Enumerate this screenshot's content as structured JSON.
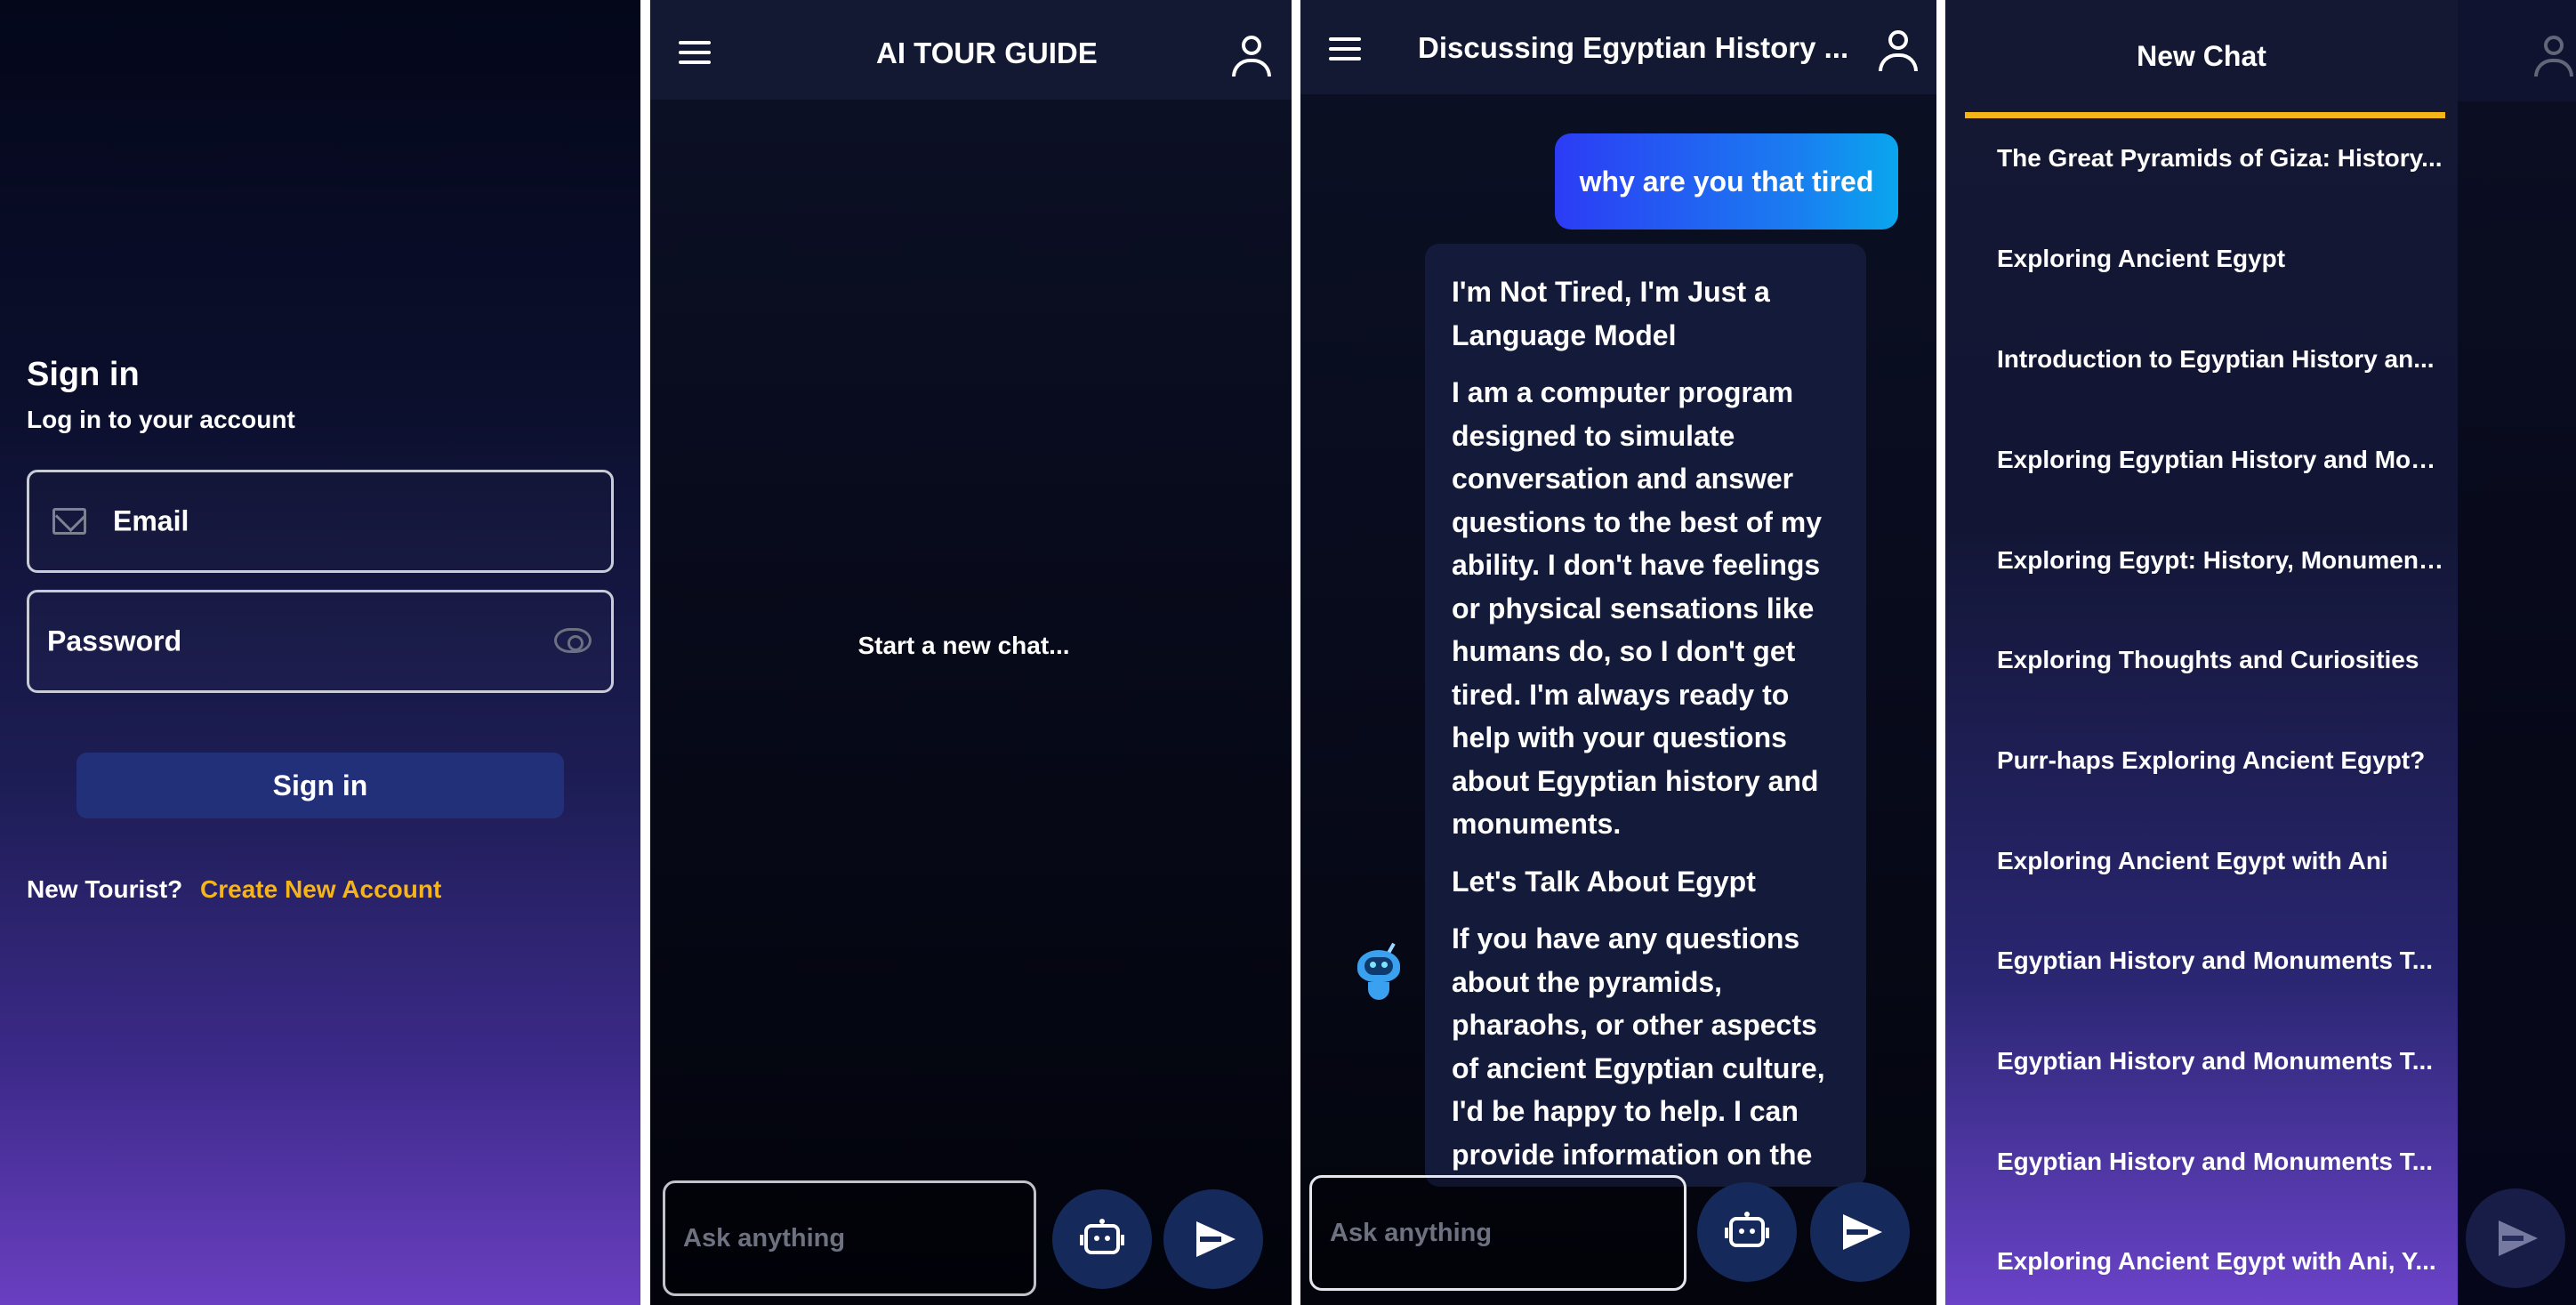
{
  "signin": {
    "title": "Sign in",
    "subtitle": "Log in to your account",
    "email_label": "Email",
    "password_label": "Password",
    "button_label": "Sign in",
    "new_tourist_text": "New Tourist?",
    "create_account_link": "Create New Account",
    "accent_color": "#f4b41a"
  },
  "home": {
    "title": "AI TOUR GUIDE",
    "empty_text": "Start a new chat...",
    "input_placeholder": "Ask anything"
  },
  "chat": {
    "title": "Discussing Egyptian History ...",
    "user_message": "why are you that tired",
    "bot_paragraphs": [
      "I'm Not Tired, I'm Just a Language Model",
      "I am a computer program designed to simulate conversation and answer questions to the best of my ability. I don't have feelings or physical sensations like humans do, so I don't get tired. I'm always ready to help with your questions about Egyptian history and monuments.",
      "Let's Talk About Egypt",
      "If you have any questions about the pyramids, pharaohs, or other aspects of ancient Egyptian culture, I'd be happy to help. I can provide information on the"
    ],
    "input_placeholder": "Ask anything"
  },
  "drawer": {
    "title": "New Chat",
    "items": [
      "The Great Pyramids of Giza: History...",
      "Exploring Ancient Egypt",
      "Introduction to Egyptian History an...",
      "Exploring Egyptian History and Mon...",
      "Exploring Egypt: History, Monument...",
      "Exploring Thoughts and Curiosities",
      "Purr-haps Exploring Ancient Egypt?",
      "Exploring Ancient Egypt with Ani",
      "Egyptian History and Monuments T...",
      "Egyptian History and Monuments T...",
      "Egyptian History and Monuments T...",
      "Exploring Ancient Egypt with Ani, Y..."
    ]
  },
  "icons": {
    "menu": "hamburger-menu-icon",
    "profile": "person-icon",
    "robot": "robot-icon",
    "send": "send-icon",
    "mail": "mail-icon",
    "eye": "eye-icon"
  }
}
